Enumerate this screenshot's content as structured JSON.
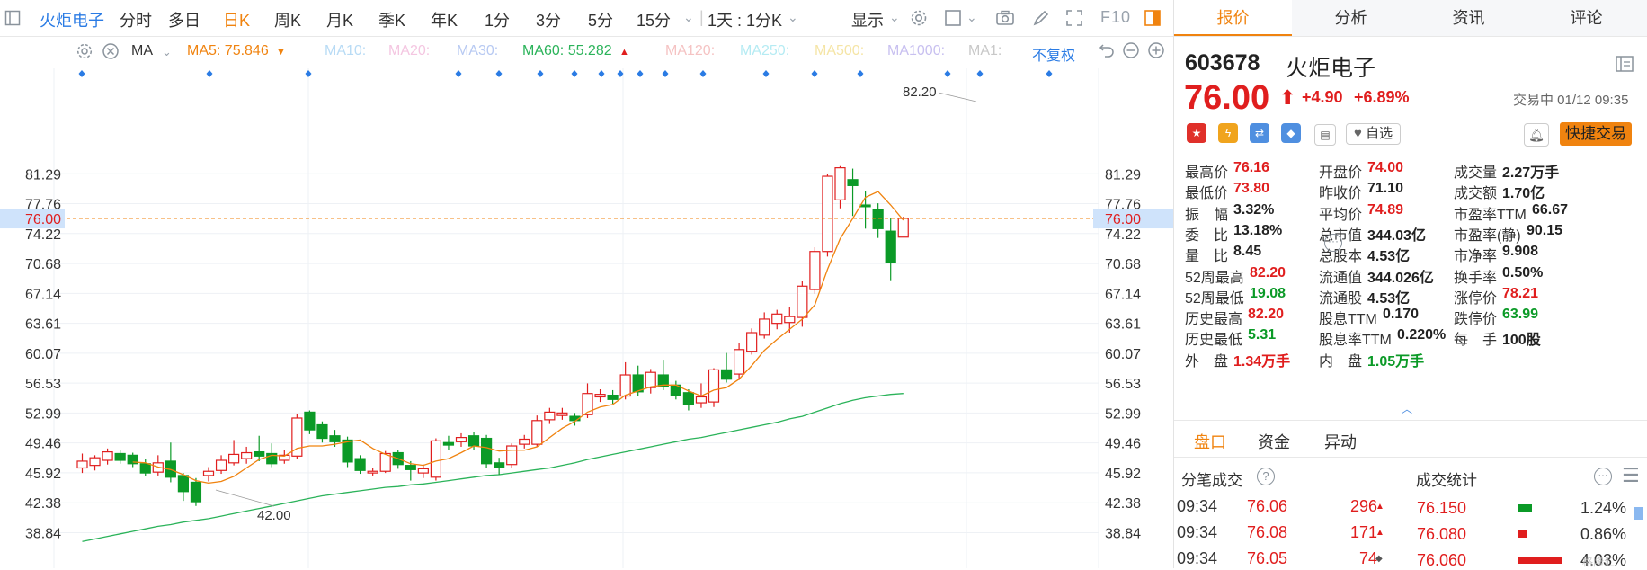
{
  "toolbar": {
    "stock_name": "火炬电子",
    "periods": [
      "分时",
      "多日",
      "日K",
      "周K",
      "月K",
      "季K",
      "年K",
      "1分",
      "3分",
      "5分",
      "15分"
    ],
    "active_period": "日K",
    "range_select": "1天 : 1分K",
    "display_label": "显示",
    "f10_label": "F10"
  },
  "indicator_bar": {
    "ma_label": "MA",
    "ma5": "MA5: 75.846",
    "ma10": "MA10:",
    "ma20": "MA20:",
    "ma30": "MA30:",
    "ma60": "MA60: 55.282",
    "ma120": "MA120:",
    "ma250": "MA250:",
    "ma500": "MA500:",
    "ma1000": "MA1000:",
    "ma1": "MA1:",
    "adjust_label": "不复权"
  },
  "chart_data": {
    "type": "candlestick",
    "price_ticks": [
      "81.29",
      "77.76",
      "74.22",
      "70.68",
      "67.14",
      "63.61",
      "60.07",
      "56.53",
      "52.99",
      "49.46",
      "45.92",
      "42.38",
      "38.84"
    ],
    "current_price_label": "76.00",
    "high_annotation": "82.20",
    "low_annotation": "42.00",
    "candles": [
      {
        "o": 46.5,
        "c": 47.3,
        "h": 48.2,
        "l": 45.9
      },
      {
        "o": 46.8,
        "c": 47.7,
        "h": 48.0,
        "l": 46.2
      },
      {
        "o": 47.4,
        "c": 48.4,
        "h": 48.8,
        "l": 46.9
      },
      {
        "o": 48.2,
        "c": 47.4,
        "h": 48.6,
        "l": 47.0
      },
      {
        "o": 48.0,
        "c": 47.0,
        "h": 48.3,
        "l": 46.6
      },
      {
        "o": 47.0,
        "c": 45.9,
        "h": 47.6,
        "l": 45.5
      },
      {
        "o": 46.0,
        "c": 47.1,
        "h": 48.0,
        "l": 45.6
      },
      {
        "o": 47.3,
        "c": 45.4,
        "h": 49.5,
        "l": 44.8
      },
      {
        "o": 45.6,
        "c": 43.7,
        "h": 45.9,
        "l": 42.6
      },
      {
        "o": 44.8,
        "c": 42.5,
        "h": 45.3,
        "l": 42.0
      },
      {
        "o": 45.6,
        "c": 46.1,
        "h": 46.6,
        "l": 44.9
      },
      {
        "o": 46.2,
        "c": 47.4,
        "h": 48.0,
        "l": 45.8
      },
      {
        "o": 47.1,
        "c": 48.1,
        "h": 49.8,
        "l": 46.8
      },
      {
        "o": 47.6,
        "c": 48.3,
        "h": 49.0,
        "l": 47.0
      },
      {
        "o": 48.4,
        "c": 47.9,
        "h": 50.3,
        "l": 47.3
      },
      {
        "o": 48.2,
        "c": 47.0,
        "h": 49.4,
        "l": 46.6
      },
      {
        "o": 47.4,
        "c": 48.0,
        "h": 48.6,
        "l": 47.0
      },
      {
        "o": 47.9,
        "c": 52.4,
        "h": 52.9,
        "l": 47.6
      },
      {
        "o": 53.1,
        "c": 51.0,
        "h": 53.3,
        "l": 50.5
      },
      {
        "o": 51.6,
        "c": 50.0,
        "h": 52.0,
        "l": 49.5
      },
      {
        "o": 50.3,
        "c": 49.6,
        "h": 51.0,
        "l": 49.0
      },
      {
        "o": 49.8,
        "c": 47.2,
        "h": 50.2,
        "l": 46.6
      },
      {
        "o": 47.6,
        "c": 46.2,
        "h": 48.0,
        "l": 45.8
      },
      {
        "o": 45.9,
        "c": 46.1,
        "h": 46.5,
        "l": 45.6
      },
      {
        "o": 46.1,
        "c": 48.2,
        "h": 48.5,
        "l": 45.9
      },
      {
        "o": 48.3,
        "c": 46.9,
        "h": 48.6,
        "l": 46.4
      },
      {
        "o": 46.8,
        "c": 46.3,
        "h": 47.3,
        "l": 45.0
      },
      {
        "o": 45.9,
        "c": 46.4,
        "h": 46.9,
        "l": 45.3
      },
      {
        "o": 45.4,
        "c": 49.7,
        "h": 50.0,
        "l": 45.0
      },
      {
        "o": 49.5,
        "c": 49.2,
        "h": 50.3,
        "l": 48.6
      },
      {
        "o": 49.6,
        "c": 50.1,
        "h": 50.6,
        "l": 49.0
      },
      {
        "o": 50.3,
        "c": 49.1,
        "h": 50.7,
        "l": 48.6
      },
      {
        "o": 50.0,
        "c": 47.0,
        "h": 50.4,
        "l": 46.5
      },
      {
        "o": 47.1,
        "c": 46.6,
        "h": 47.7,
        "l": 45.7
      },
      {
        "o": 46.9,
        "c": 49.1,
        "h": 49.4,
        "l": 46.5
      },
      {
        "o": 49.3,
        "c": 49.9,
        "h": 50.4,
        "l": 48.8
      },
      {
        "o": 49.3,
        "c": 52.1,
        "h": 52.7,
        "l": 49.0
      },
      {
        "o": 52.2,
        "c": 53.1,
        "h": 53.6,
        "l": 51.7
      },
      {
        "o": 52.7,
        "c": 53.0,
        "h": 53.6,
        "l": 52.2
      },
      {
        "o": 52.6,
        "c": 52.1,
        "h": 53.0,
        "l": 51.5
      },
      {
        "o": 52.8,
        "c": 55.3,
        "h": 56.5,
        "l": 52.4
      },
      {
        "o": 54.9,
        "c": 55.2,
        "h": 55.8,
        "l": 54.3
      },
      {
        "o": 55.1,
        "c": 54.6,
        "h": 55.7,
        "l": 54.1
      },
      {
        "o": 55.0,
        "c": 57.5,
        "h": 59.0,
        "l": 54.6
      },
      {
        "o": 57.5,
        "c": 55.5,
        "h": 58.6,
        "l": 55.0
      },
      {
        "o": 56.0,
        "c": 57.8,
        "h": 58.2,
        "l": 55.3
      },
      {
        "o": 57.5,
        "c": 56.1,
        "h": 59.3,
        "l": 55.7
      },
      {
        "o": 56.3,
        "c": 55.1,
        "h": 56.8,
        "l": 54.6
      },
      {
        "o": 55.4,
        "c": 54.0,
        "h": 55.8,
        "l": 53.3
      },
      {
        "o": 54.2,
        "c": 54.9,
        "h": 56.5,
        "l": 53.6
      },
      {
        "o": 54.3,
        "c": 58.1,
        "h": 58.3,
        "l": 53.7
      },
      {
        "o": 58.1,
        "c": 57.0,
        "h": 60.1,
        "l": 56.6
      },
      {
        "o": 57.6,
        "c": 60.5,
        "h": 61.3,
        "l": 56.9
      },
      {
        "o": 60.3,
        "c": 62.5,
        "h": 63.0,
        "l": 59.9
      },
      {
        "o": 62.2,
        "c": 64.1,
        "h": 64.9,
        "l": 61.8
      },
      {
        "o": 63.6,
        "c": 64.7,
        "h": 65.2,
        "l": 62.9
      },
      {
        "o": 63.7,
        "c": 64.4,
        "h": 65.5,
        "l": 62.5
      },
      {
        "o": 64.3,
        "c": 68.0,
        "h": 68.6,
        "l": 63.2
      },
      {
        "o": 67.6,
        "c": 72.1,
        "h": 72.6,
        "l": 67.1
      },
      {
        "o": 72.1,
        "c": 81.0,
        "h": 81.3,
        "l": 71.5
      },
      {
        "o": 78.2,
        "c": 82.0,
        "h": 82.2,
        "l": 77.2
      },
      {
        "o": 80.6,
        "c": 79.9,
        "h": 81.9,
        "l": 76.3
      },
      {
        "o": 77.6,
        "c": 77.4,
        "h": 79.3,
        "l": 74.8
      },
      {
        "o": 77.1,
        "c": 74.8,
        "h": 77.8,
        "l": 73.7
      },
      {
        "o": 74.5,
        "c": 70.8,
        "h": 76.0,
        "l": 68.7
      },
      {
        "o": 73.8,
        "c": 76.0,
        "h": 76.2,
        "l": 73.8
      }
    ],
    "ma5": [
      null,
      null,
      null,
      null,
      47.2,
      47.1,
      46.6,
      46.3,
      45.7,
      45.0,
      44.7,
      44.9,
      45.5,
      46.5,
      47.5,
      48.0,
      47.9,
      48.8,
      49.1,
      49.1,
      49.3,
      49.6,
      49.8,
      48.8,
      48.1,
      47.6,
      47.0,
      46.8,
      47.3,
      47.6,
      48.3,
      49.1,
      48.9,
      48.5,
      48.6,
      48.6,
      49.0,
      50.1,
      51.2,
      52.0,
      53.1,
      53.7,
      54.0,
      55.1,
      55.6,
      56.1,
      56.3,
      56.3,
      55.6,
      55.0,
      55.7,
      56.0,
      57.0,
      58.6,
      60.4,
      61.7,
      62.9,
      64.1,
      65.8,
      70.0,
      73.6,
      76.0,
      78.5,
      79.2,
      77.6,
      75.8
    ],
    "ma60": [
      37.8,
      38.1,
      38.4,
      38.7,
      39.0,
      39.3,
      39.6,
      39.8,
      40.1,
      40.3,
      40.5,
      40.8,
      41.1,
      41.4,
      41.7,
      42.0,
      42.3,
      42.6,
      42.9,
      43.2,
      43.4,
      43.6,
      43.8,
      44.0,
      44.2,
      44.3,
      44.5,
      44.6,
      44.8,
      45.0,
      45.2,
      45.4,
      45.6,
      45.7,
      45.9,
      46.1,
      46.3,
      46.5,
      46.8,
      47.1,
      47.5,
      47.8,
      48.1,
      48.4,
      48.7,
      49.0,
      49.3,
      49.6,
      49.9,
      50.1,
      50.4,
      50.7,
      51.0,
      51.3,
      51.6,
      51.9,
      52.3,
      52.6,
      53.1,
      53.6,
      54.1,
      54.5,
      54.8,
      55.0,
      55.2,
      55.3
    ]
  },
  "quote": {
    "tabs": [
      "报价",
      "分析",
      "资讯",
      "评论"
    ],
    "active_tab": "报价",
    "code": "603678",
    "name": "火炬电子",
    "price": "76.00",
    "change": "+4.90",
    "change_pct": "+6.89%",
    "status": "交易中 01/12 09:35",
    "watch_label": "自选",
    "quick_trade_label": "快捷交易",
    "fields": [
      {
        "label": "最高价",
        "value": "76.16",
        "color": "red"
      },
      {
        "label": "开盘价",
        "value": "74.00",
        "color": "red"
      },
      {
        "label": "成交量",
        "value": "2.27万手",
        "color": "dark"
      },
      {
        "label": "最低价",
        "value": "73.80",
        "color": "red"
      },
      {
        "label": "昨收价",
        "value": "71.10",
        "color": "dark"
      },
      {
        "label": "成交额",
        "value": "1.70亿",
        "color": "dark"
      },
      {
        "label": "振　幅",
        "value": "3.32%",
        "color": "dark"
      },
      {
        "label": "平均价",
        "value": "74.89",
        "color": "red"
      },
      {
        "label": "市盈率TTM",
        "value": "66.67",
        "color": "dark"
      },
      {
        "label": "委　比",
        "value": "13.18%",
        "color": "dark"
      },
      {
        "label": "总市值",
        "value": "344.03亿",
        "color": "dark"
      },
      {
        "label": "市盈率(静)",
        "value": "90.15",
        "color": "dark"
      },
      {
        "label": "量　比",
        "value": "8.45",
        "color": "dark"
      },
      {
        "label": "总股本",
        "value": "4.53亿",
        "color": "dark"
      },
      {
        "label": "市净率",
        "value": "9.908",
        "color": "dark"
      },
      {
        "label": "52周最高",
        "value": "82.20",
        "color": "red"
      },
      {
        "label": "流通值",
        "value": "344.026亿",
        "color": "dark"
      },
      {
        "label": "换手率",
        "value": "0.50%",
        "color": "dark"
      },
      {
        "label": "52周最低",
        "value": "19.08",
        "color": "green"
      },
      {
        "label": "流通股",
        "value": "4.53亿",
        "color": "dark"
      },
      {
        "label": "涨停价",
        "value": "78.21",
        "color": "red"
      },
      {
        "label": "历史最高",
        "value": "82.20",
        "color": "red"
      },
      {
        "label": "股息TTM",
        "value": "0.170",
        "color": "dark"
      },
      {
        "label": "跌停价",
        "value": "63.99",
        "color": "green"
      },
      {
        "label": "历史最低",
        "value": "5.31",
        "color": "green"
      },
      {
        "label": "股息率TTM",
        "value": "0.220%",
        "color": "dark"
      },
      {
        "label": "每　手",
        "value": "100股",
        "color": "dark"
      },
      {
        "label": "外　盘",
        "value": "1.34万手",
        "color": "red"
      },
      {
        "label": "内　盘",
        "value": "1.05万手",
        "color": "green"
      }
    ]
  },
  "panel": {
    "tabs": [
      "盘口",
      "资金",
      "异动"
    ],
    "active_tab": "盘口",
    "ticks_title": "分笔成交",
    "stats_title": "成交统计",
    "ticks": [
      {
        "time": "09:34",
        "price": "76.06",
        "vol": "296"
      },
      {
        "time": "09:34",
        "price": "76.08",
        "vol": "171"
      },
      {
        "time": "09:34",
        "price": "76.05",
        "vol": "74"
      }
    ],
    "stats": [
      {
        "price": "76.150",
        "pct": "1.24%",
        "bar": 1.24
      },
      {
        "price": "76.080",
        "pct": "0.86%",
        "bar": 0.86
      },
      {
        "price": "76.060",
        "pct": "4.03%",
        "bar": 4.03
      }
    ],
    "watermark": "格隆汇"
  },
  "colors": {
    "up": "#e01e1e",
    "down": "#0b9a27",
    "ma5": "#f0830f",
    "ma60": "#2bb35a",
    "accent": "#f0830f",
    "link": "#2a7be4"
  }
}
